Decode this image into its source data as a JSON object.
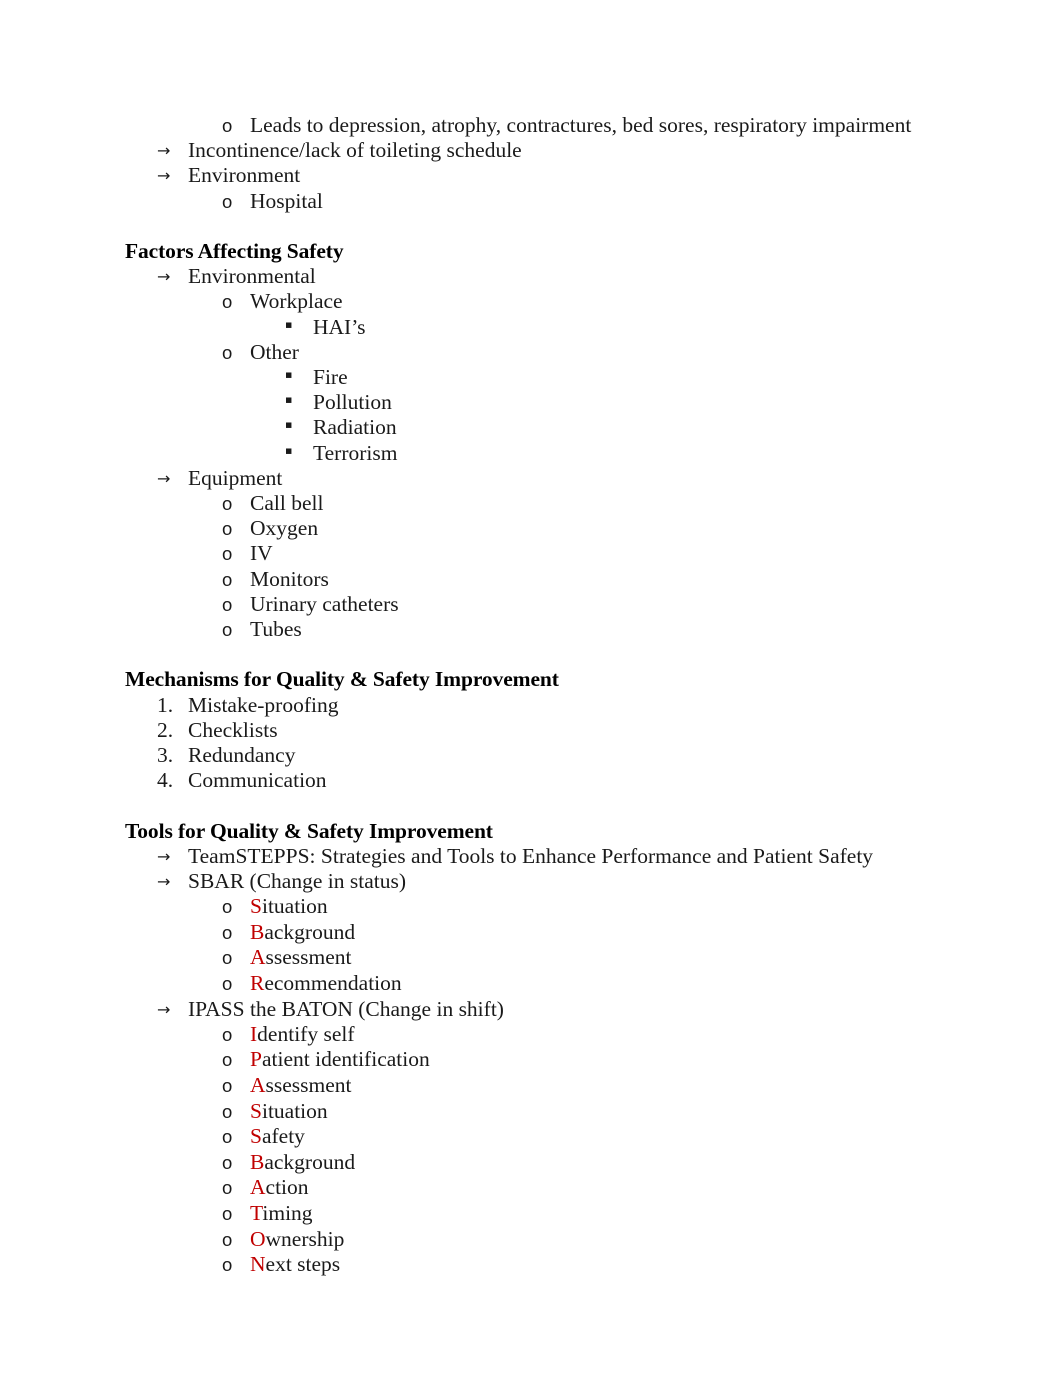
{
  "document": {
    "accent_color": "#C00000",
    "text_color": "#1a1a1a",
    "markers": {
      "arrow": "→",
      "circle": "o",
      "square": "▪"
    },
    "blocks": [
      {
        "id": "intro-continued",
        "items": [
          {
            "level": 2,
            "marker": "circle",
            "text": "Leads to depression, atrophy, contractures, bed sores, respiratory impairment"
          },
          {
            "level": 1,
            "marker": "arrow",
            "text": "Incontinence/lack of toileting schedule"
          },
          {
            "level": 1,
            "marker": "arrow",
            "text": "Environment"
          },
          {
            "level": 2,
            "marker": "circle",
            "text": "Hospital"
          }
        ]
      },
      {
        "id": "factors-affecting-safety",
        "heading": "Factors Affecting Safety",
        "items": [
          {
            "level": 1,
            "marker": "arrow",
            "text": "Environmental"
          },
          {
            "level": 2,
            "marker": "circle",
            "text": "Workplace"
          },
          {
            "level": 3,
            "marker": "square",
            "text": "HAI’s"
          },
          {
            "level": 2,
            "marker": "circle",
            "text": "Other"
          },
          {
            "level": 3,
            "marker": "square",
            "text": "Fire"
          },
          {
            "level": 3,
            "marker": "square",
            "text": "Pollution"
          },
          {
            "level": 3,
            "marker": "square",
            "text": "Radiation"
          },
          {
            "level": 3,
            "marker": "square",
            "text": "Terrorism"
          },
          {
            "level": 1,
            "marker": "arrow",
            "text": "Equipment"
          },
          {
            "level": 2,
            "marker": "circle",
            "text": "Call bell"
          },
          {
            "level": 2,
            "marker": "circle",
            "text": "Oxygen"
          },
          {
            "level": 2,
            "marker": "circle",
            "text": "IV"
          },
          {
            "level": 2,
            "marker": "circle",
            "text": "Monitors"
          },
          {
            "level": 2,
            "marker": "circle",
            "text": "Urinary catheters"
          },
          {
            "level": 2,
            "marker": "circle",
            "text": "Tubes"
          }
        ]
      },
      {
        "id": "mechanisms-for-quality-and-safety-improvement",
        "heading": "Mechanisms for Quality & Safety Improvement",
        "items": [
          {
            "level": 1,
            "marker": "number",
            "number": "1.",
            "text": "Mistake-proofing"
          },
          {
            "level": 1,
            "marker": "number",
            "number": "2.",
            "text": "Checklists"
          },
          {
            "level": 1,
            "marker": "number",
            "number": "3.",
            "text": "Redundancy"
          },
          {
            "level": 1,
            "marker": "number",
            "number": "4.",
            "text": "Communication"
          }
        ]
      },
      {
        "id": "tools-for-quality-and-safety-improvement",
        "heading": "Tools for Quality & Safety Improvement",
        "items": [
          {
            "level": 1,
            "marker": "arrow",
            "text": "TeamSTEPPS: Strategies and Tools to Enhance Performance and Patient Safety"
          },
          {
            "level": 1,
            "marker": "arrow",
            "text": "SBAR (Change in status)"
          },
          {
            "level": 2,
            "marker": "circle",
            "initial": "S",
            "text": "ituation"
          },
          {
            "level": 2,
            "marker": "circle",
            "initial": "B",
            "text": "ackground"
          },
          {
            "level": 2,
            "marker": "circle",
            "initial": "A",
            "text": "ssessment"
          },
          {
            "level": 2,
            "marker": "circle",
            "initial": "R",
            "text": "ecommendation"
          },
          {
            "level": 1,
            "marker": "arrow",
            "text": "IPASS the BATON (Change in shift)"
          },
          {
            "level": 2,
            "marker": "circle",
            "initial": "I",
            "text": "dentify self"
          },
          {
            "level": 2,
            "marker": "circle",
            "initial": "P",
            "text": "atient identification"
          },
          {
            "level": 2,
            "marker": "circle",
            "initial": "A",
            "text": "ssessment"
          },
          {
            "level": 2,
            "marker": "circle",
            "initial": "S",
            "text": "ituation"
          },
          {
            "level": 2,
            "marker": "circle",
            "initial": "S",
            "text": "afety"
          },
          {
            "level": 2,
            "marker": "circle",
            "initial": "B",
            "text": "ackground"
          },
          {
            "level": 2,
            "marker": "circle",
            "initial": "A",
            "text": "ction"
          },
          {
            "level": 2,
            "marker": "circle",
            "initial": "T",
            "text": "iming"
          },
          {
            "level": 2,
            "marker": "circle",
            "initial": "O",
            "text": "wnership"
          },
          {
            "level": 2,
            "marker": "circle",
            "initial": "N",
            "text": "ext steps"
          }
        ]
      }
    ]
  }
}
